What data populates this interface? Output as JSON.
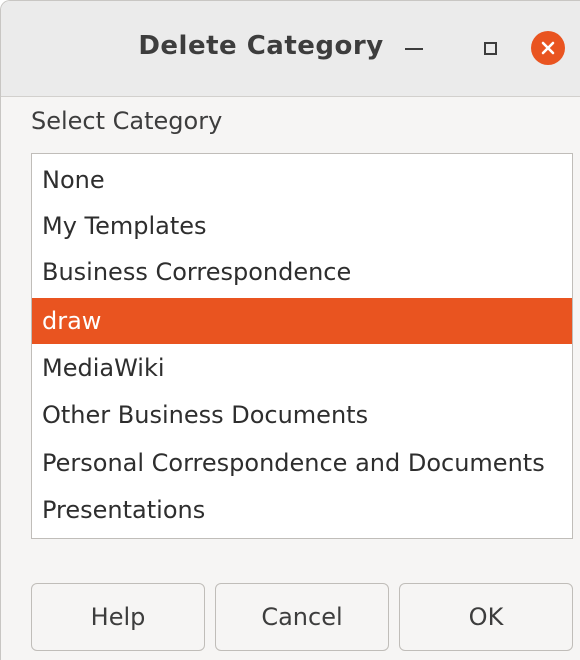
{
  "window": {
    "title": "Delete Category"
  },
  "dialog": {
    "section_label": "Select Category",
    "categories": [
      "None",
      "My Templates",
      "Business Correspondence",
      "draw",
      "MediaWiki",
      "Other Business Documents",
      "Personal Correspondence and Documents",
      "Presentations"
    ],
    "selected": "draw"
  },
  "buttons": {
    "help": "Help",
    "cancel": "Cancel",
    "ok": "OK"
  },
  "colors": {
    "accent": "#e95420"
  },
  "icons": {
    "minimize": "minimize-icon",
    "maximize": "maximize-icon",
    "close": "close-icon"
  }
}
